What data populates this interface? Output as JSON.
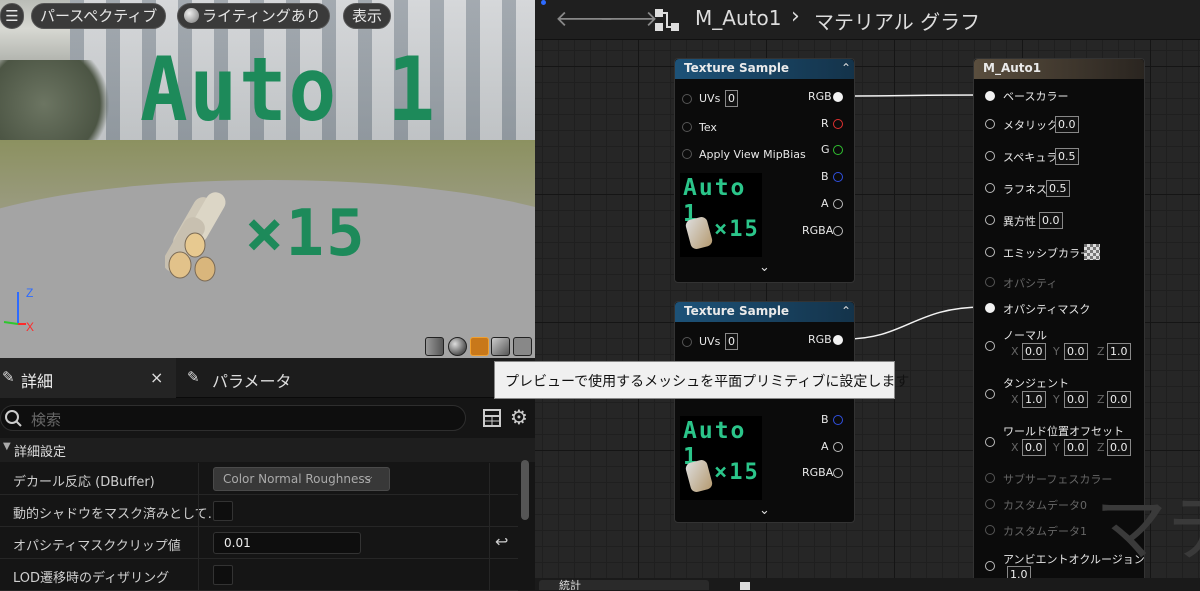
{
  "viewport": {
    "menu_icon": "hamburger-icon",
    "perspective_label": "パースペクティブ",
    "lighting_label": "ライティングあり",
    "show_label": "表示",
    "preview_title": "Auto 1",
    "preview_count": "×15",
    "axis_z": "Z",
    "axis_x": "X",
    "axis_y": "Y"
  },
  "details": {
    "tab_details": "詳細",
    "tab_close": "×",
    "tab_parameters": "パラメータ",
    "search_placeholder": "検索",
    "category": "詳細設定",
    "rows": [
      {
        "label": "デカール反応 (DBuffer)",
        "value": "Color Normal Roughness"
      },
      {
        "label": "動的シャドウをマスク済みとして…",
        "value": ""
      },
      {
        "label": "オパシティマスククリップ値",
        "value": "0.01"
      },
      {
        "label": "LOD遷移時のディザリング",
        "value": ""
      }
    ],
    "bottom_tab": "統計"
  },
  "graph": {
    "title": "M_Auto1",
    "subtitle": "マテリアル グラフ",
    "breadcrumb_sep": "›",
    "watermark": "マテ",
    "texture_node_1": {
      "title": "Texture Sample",
      "inputs": [
        "UVs",
        "Tex",
        "Apply View MipBias"
      ],
      "uvs_value": "0",
      "outputs": [
        "RGB",
        "R",
        "G",
        "B",
        "A",
        "RGBA"
      ],
      "thumb_title": "Auto 1",
      "thumb_count": "×15"
    },
    "texture_node_2": {
      "title": "Texture Sample",
      "inputs": [
        "UVs"
      ],
      "uvs_value": "0",
      "outputs": [
        "RGB",
        "B",
        "A",
        "RGBA"
      ],
      "thumb_title": "Auto 1",
      "thumb_count": "×15"
    },
    "material_node": {
      "title": "M_Auto1",
      "base_color": "ベースカラー",
      "metallic": "メタリック",
      "metallic_value": "0.0",
      "specular": "スペキュラ",
      "specular_value": "0.5",
      "roughness": "ラフネス",
      "roughness_value": "0.5",
      "anisotropy": "異方性",
      "anisotropy_value": "0.0",
      "emissive": "エミッシブカラー",
      "opacity": "オパシティ",
      "opacity_mask": "オパシティマスク",
      "normal": "ノーマル",
      "normal_x": "0.0",
      "normal_y": "0.0",
      "normal_z": "1.0",
      "tangent": "タンジェント",
      "tangent_x": "1.0",
      "tangent_y": "0.0",
      "tangent_z": "0.0",
      "wpo": "ワールド位置オフセット",
      "wpo_x": "0.0",
      "wpo_y": "0.0",
      "wpo_z": "0.0",
      "subsurface": "サブサーフェスカラー",
      "custom0": "カスタムデータ0",
      "custom1": "カスタムデータ1",
      "ao": "アンビエントオクルージョン",
      "ao_value": "1.0",
      "axis_x": "X",
      "axis_y": "Y",
      "axis_z": "Z"
    },
    "tooltip": "プレビューで使用するメッシュを平面プリミティブに設定します"
  },
  "colors": {
    "accent": "#1d5278",
    "text_green": "#1d8a5a",
    "pin_red": "#e03030",
    "pin_green": "#30c030",
    "pin_blue": "#3050e0"
  }
}
